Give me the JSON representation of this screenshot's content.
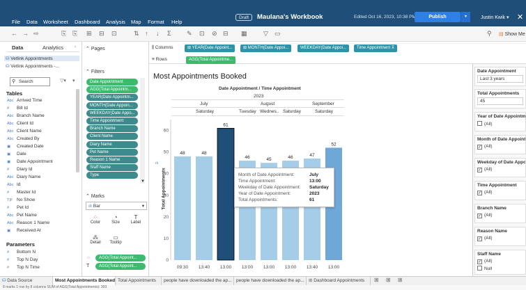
{
  "menu": [
    "File",
    "Data",
    "Worksheet",
    "Dashboard",
    "Analysis",
    "Map",
    "Format",
    "Help"
  ],
  "title": {
    "draft": "Draft",
    "workbook": "Maulana's Workbook",
    "edited": "Edited Oct 16, 2023, 10:38 PM",
    "publish": "Publish",
    "user": "Justin Kwik"
  },
  "toolbar": {
    "show_me": "Show Me"
  },
  "data_pane": {
    "tab_data": "Data",
    "tab_analytics": "Analytics",
    "datasources": [
      "Vetlink Appointments",
      "Vetlink Appointments -..."
    ],
    "search_placeholder": "Search",
    "tables_heading": "Tables",
    "fields": [
      {
        "type": "Abc",
        "name": "Arrived Time"
      },
      {
        "type": "#",
        "name": "Bill Id"
      },
      {
        "type": "Abc",
        "name": "Branch Name"
      },
      {
        "type": "Abc",
        "name": "Client Id"
      },
      {
        "type": "Abc",
        "name": "Client Name"
      },
      {
        "type": "Abc",
        "name": "Created By"
      },
      {
        "type": "cal",
        "name": "Created Date"
      },
      {
        "type": "cal",
        "name": "Date"
      },
      {
        "type": "cal",
        "name": "Date Appointment"
      },
      {
        "type": "#",
        "name": "Diary Id"
      },
      {
        "type": "Abc",
        "name": "Diary Name"
      },
      {
        "type": "Abc",
        "name": "Id"
      },
      {
        "type": "#",
        "name": "Master Id"
      },
      {
        "type": "T|F",
        "name": "No Show"
      },
      {
        "type": "#",
        "name": "Pet Id"
      },
      {
        "type": "Abc",
        "name": "Pet Name"
      },
      {
        "type": "Abc",
        "name": "Reason 1 Name"
      },
      {
        "type": "cal",
        "name": "Received At"
      }
    ],
    "parameters_heading": "Parameters",
    "parameters": [
      "Bottom N",
      "Top N Day",
      "Top N Time"
    ]
  },
  "cards": {
    "pages": "Pages",
    "filters": "Filters",
    "filter_pills": [
      "Date Appointment",
      "AGG(Total Appointm...",
      "YEAR(Date Appointm...",
      "MONTH(Date Appoin...",
      "WEEKDAY(Date Appo...",
      "Time Appointment",
      "Branch Name",
      "Client Name",
      "Diary Name",
      "Pet Name",
      "Reason 1 Name",
      "Staff Name",
      "Type"
    ],
    "marks": "Marks",
    "mark_type": "Bar",
    "mark_buttons": [
      "Color",
      "Size",
      "Label",
      "Detail",
      "Tooltip"
    ],
    "mark_pills": [
      "AGG(Total Appoint...",
      "AGG(Total Appoint..."
    ]
  },
  "shelves": {
    "columns_label": "Columns",
    "rows_label": "Rows",
    "columns": [
      "YEAR(Date Appoint...",
      "MONTH(Date Appoi...",
      "WEEKDAY(Date Appoi...",
      "Time Appointment"
    ],
    "rows": [
      "AGG(Total Appointme..."
    ]
  },
  "viz": {
    "title": "Most Appointments Booked",
    "header_title": "Date Appointment / Time Appointment",
    "year": "2023",
    "months": [
      "July",
      "August",
      "September"
    ],
    "weekdays": [
      "Saturday",
      "Tuesday",
      "Wednes..",
      "Saturday",
      "Saturday"
    ],
    "ylabel": "Total Appointments"
  },
  "chart_data": {
    "type": "bar",
    "title": "Most Appointments Booked",
    "ylabel": "Total Appointments",
    "ylim": [
      0,
      65
    ],
    "yticks": [
      0,
      10,
      20,
      30,
      40,
      50,
      60
    ],
    "categories": [
      "09:30",
      "13:40",
      "13:00",
      "13:00",
      "13:00",
      "13:00",
      "13:40",
      "13:00"
    ],
    "values": [
      48,
      48,
      61,
      46,
      45,
      46,
      47,
      52
    ],
    "colors": [
      "#a6cde8",
      "#a6cde8",
      "#1f4e79",
      "#a6cde8",
      "#a6cde8",
      "#a6cde8",
      "#a6cde8",
      "#6fa8d6"
    ]
  },
  "tooltip": {
    "rows": [
      {
        "label": "Month of Date Appointment:",
        "value": "July"
      },
      {
        "label": "Time Appointment:",
        "value": "13:00"
      },
      {
        "label": "Weekday of Date Appointment:",
        "value": "Saturday"
      },
      {
        "label": "Year of Date Appointment:",
        "value": "2023"
      },
      {
        "label": "Total Appointments:",
        "value": "61"
      }
    ]
  },
  "filters_right": [
    {
      "title": "Date Appointment",
      "value": "Last 3 years"
    },
    {
      "title": "Total Appointments",
      "value": "45"
    },
    {
      "title": "Year of Date Appointmen",
      "value": "(All)"
    },
    {
      "title": "Month of Date Appoint...",
      "value": "(All)"
    },
    {
      "title": "Weekday of Date Appointm",
      "value": "(All)"
    },
    {
      "title": "Time Appointment",
      "value": "(All)"
    },
    {
      "title": "Branch Name",
      "value": "(All)"
    },
    {
      "title": "Reason Name",
      "value": "(All)"
    },
    {
      "title": "Staff Name",
      "value": "(All)",
      "extra": "Null"
    }
  ],
  "tabs": [
    "Data Source",
    "Most Appointments Booked",
    "Total Appointments",
    "people have downloaded the ap...",
    "people have downloaded the ap...",
    "Dashboard Appointments"
  ],
  "status": "8 marks   1 row by 8 columns   SUM of AGG(Total Appointments): 393"
}
